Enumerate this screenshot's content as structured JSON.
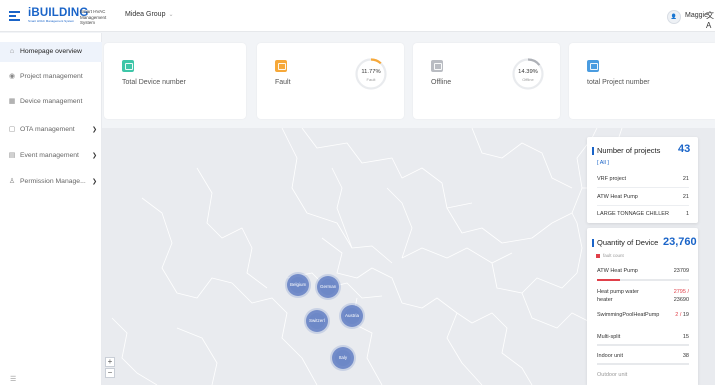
{
  "header": {
    "logo": "iBUILDING",
    "logo_sub": "Smart HVAC Management System",
    "system_name": "Smart HVAC Management System",
    "group": "Midea Group",
    "user_avatar": "👤",
    "user": "Maggie",
    "lang_icon": "文A"
  },
  "sidebar": {
    "items": [
      {
        "label": "Homepage overview",
        "icon": "home-icon"
      },
      {
        "label": "Project management",
        "icon": "project-icon"
      },
      {
        "label": "Device management",
        "icon": "device-icon"
      },
      {
        "label": "OTA management",
        "icon": "ota-icon"
      },
      {
        "label": "Event management",
        "icon": "event-icon"
      },
      {
        "label": "Permission Manage...",
        "icon": "permission-icon"
      }
    ]
  },
  "stats": {
    "total_device": {
      "label": "Total Device number",
      "color": "#3ec6a8"
    },
    "fault": {
      "label": "Fault",
      "percent": "11.77%",
      "sub": "Fault",
      "fraction": 0.1177,
      "color": "#f6a839"
    },
    "offline": {
      "label": "Offline",
      "percent": "14.39%",
      "sub": "Offline",
      "fraction": 0.1439,
      "color": "#b9bcc2"
    },
    "total_project": {
      "label": "total Project number",
      "color": "#4a9ce0"
    }
  },
  "map": {
    "clusters": [
      {
        "label": "Belgium"
      },
      {
        "label": "Germany"
      },
      {
        "label": "Switzerland"
      },
      {
        "label": "Austria"
      },
      {
        "label": "Italy"
      }
    ],
    "zoom_in": "+",
    "zoom_out": "−"
  },
  "projects_panel": {
    "title": "Number of projects",
    "total": "43",
    "filter": "[ All ]",
    "rows": [
      {
        "label": "VRF project",
        "value": "21"
      },
      {
        "label": "ATW Heat Pump",
        "value": "21"
      },
      {
        "label": "LARGE TONNAGE CHILLER",
        "value": "1"
      }
    ]
  },
  "devices_panel": {
    "title": "Quantity of Device",
    "total": "23,760",
    "legend": "fault count",
    "rows": [
      {
        "label": "ATW Heat Pump",
        "value": "23709",
        "fault_fraction": 0.25
      },
      {
        "label": "Heat pump water",
        "label2": "heater",
        "fault": "2795",
        "sep": "/",
        "value": "23690"
      },
      {
        "label": "SwimmingPoolHeatPump",
        "fault": "2",
        "sep": "/",
        "value": "19"
      },
      {
        "label": "Multi-split",
        "value": "15"
      },
      {
        "label": "Indoor unit",
        "value": "38"
      },
      {
        "label": "Outdoor unit",
        "value": ""
      }
    ]
  },
  "colors": {
    "accent": "#1a64c8",
    "fault_red": "#e0404a",
    "cluster": "#6d88c7"
  }
}
